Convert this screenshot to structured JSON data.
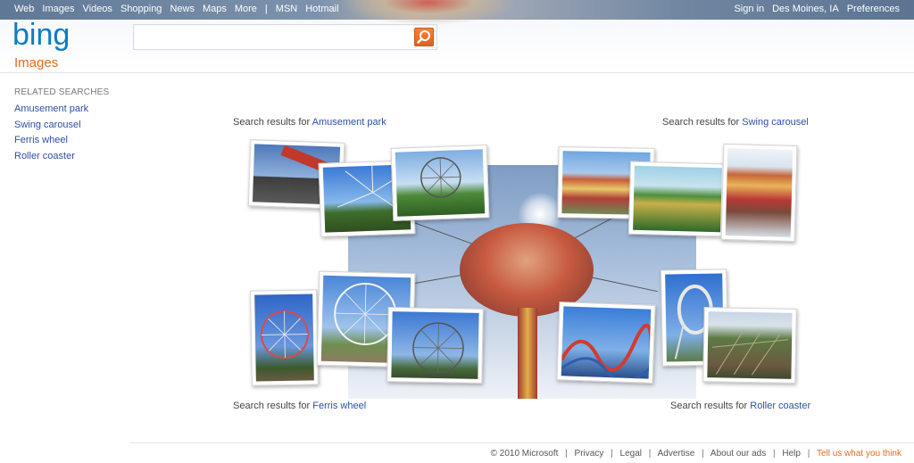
{
  "nav": {
    "left": [
      "Web",
      "Images",
      "Videos",
      "Shopping",
      "News",
      "Maps",
      "More"
    ],
    "separator": "|",
    "left_extra": [
      "MSN",
      "Hotmail"
    ],
    "right": [
      "Sign in",
      "Des Moines, IA",
      "Preferences"
    ]
  },
  "logo_text": "bing",
  "vertical_title": "Images",
  "search": {
    "value": "",
    "placeholder": ""
  },
  "related": {
    "title": "RELATED SEARCHES",
    "items": [
      "Amusement park",
      "Swing carousel",
      "Ferris wheel",
      "Roller coaster"
    ]
  },
  "captions": {
    "prefix": "Search results for",
    "top_left": "Amusement park",
    "top_right": "Swing carousel",
    "bottom_left": "Ferris wheel",
    "bottom_right": "Roller coaster"
  },
  "footer": {
    "copyright": "© 2010 Microsoft",
    "links": [
      "Privacy",
      "Legal",
      "Advertise",
      "About our ads",
      "Help"
    ],
    "feedback": "Tell us what you think"
  },
  "colors": {
    "accent": "#e16b21",
    "link": "#2e4f9f",
    "logo": "#0b7cc6"
  }
}
